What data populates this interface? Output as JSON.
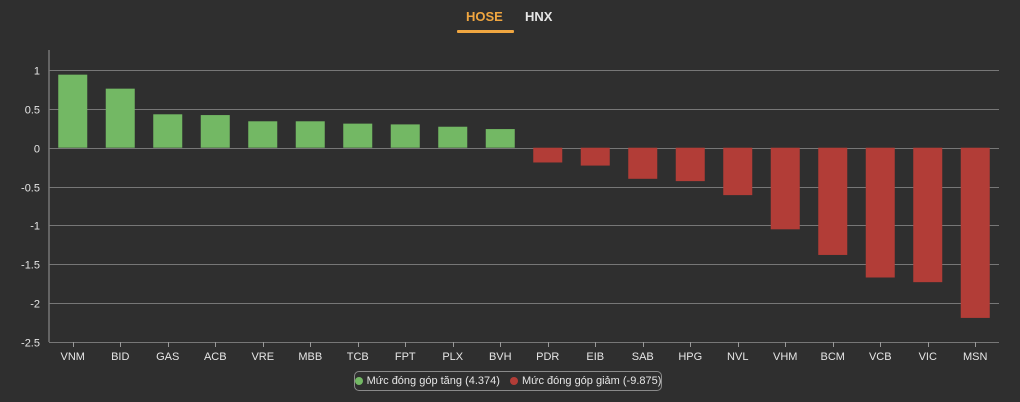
{
  "tabs": [
    {
      "label": "HOSE",
      "active": true
    },
    {
      "label": "HNX",
      "active": false
    }
  ],
  "colors": {
    "positive": "#73b864",
    "negative": "#b23d37",
    "accent": "#f0a640",
    "grid": "#777777",
    "text": "#e6e6e6"
  },
  "legend": {
    "positive_label": "Mức đóng góp tăng (4.374)",
    "negative_label": "Mức đóng góp giảm (-9.875)"
  },
  "chart_data": {
    "type": "bar",
    "categories": [
      "VNM",
      "BID",
      "GAS",
      "ACB",
      "VRE",
      "MBB",
      "TCB",
      "FPT",
      "PLX",
      "BVH",
      "PDR",
      "EIB",
      "SAB",
      "HPG",
      "NVL",
      "VHM",
      "BCM",
      "VCB",
      "VIC",
      "MSN"
    ],
    "values": [
      0.94,
      0.76,
      0.43,
      0.42,
      0.34,
      0.34,
      0.31,
      0.3,
      0.27,
      0.24,
      -0.19,
      -0.23,
      -0.4,
      -0.43,
      -0.61,
      -1.05,
      -1.38,
      -1.67,
      -1.73,
      -2.19
    ],
    "ylim": [
      -2.5,
      1
    ],
    "yticks": [
      "1",
      "0.5",
      "0",
      "-0.5",
      "-1",
      "-1.5",
      "-2",
      "-2.5"
    ],
    "ytick_values": [
      1,
      0.5,
      0,
      -0.5,
      -1,
      -1.5,
      -2,
      -2.5
    ],
    "grid": true,
    "legend_position": "bottom"
  }
}
